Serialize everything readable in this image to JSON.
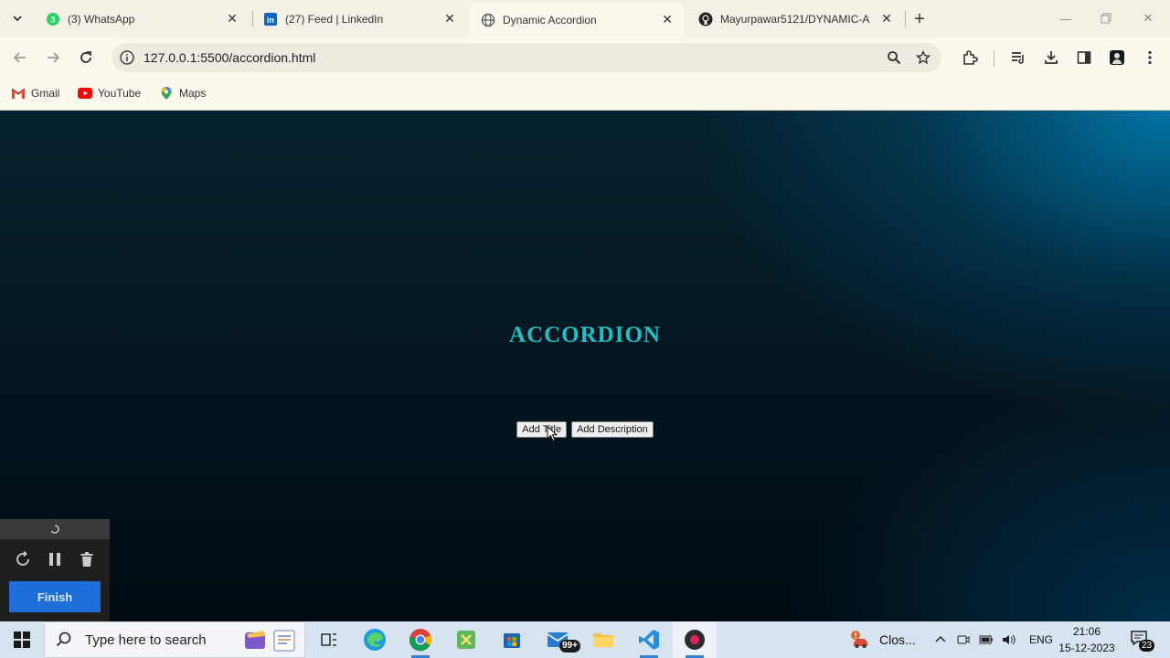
{
  "browser": {
    "tabs": [
      {
        "title": "(3) WhatsApp",
        "icon": "whatsapp-icon",
        "badge": "3",
        "active": false
      },
      {
        "title": "(27) Feed | LinkedIn",
        "icon": "linkedin-icon",
        "active": false
      },
      {
        "title": "Dynamic Accordion",
        "icon": "globe-icon",
        "active": true
      },
      {
        "title": "Mayurpawar5121/DYNAMIC-A",
        "icon": "github-icon",
        "active": false
      }
    ],
    "url": "127.0.0.1:5500/accordion.html",
    "bookmarks": [
      {
        "label": "Gmail",
        "icon": "gmail-icon"
      },
      {
        "label": "YouTube",
        "icon": "youtube-icon"
      },
      {
        "label": "Maps",
        "icon": "maps-icon"
      }
    ]
  },
  "page": {
    "heading": "ACCORDION",
    "add_title_label": "Add Title",
    "add_description_label": "Add Description",
    "heading_color": "#19c3c3"
  },
  "recorder": {
    "finish_label": "Finish"
  },
  "taskbar": {
    "search_placeholder": "Type here to search",
    "mail_badge": "99+",
    "tray_app_label": "Clos...",
    "language": "ENG",
    "time": "21:06",
    "date": "15-12-2023",
    "notification_count": "23"
  }
}
